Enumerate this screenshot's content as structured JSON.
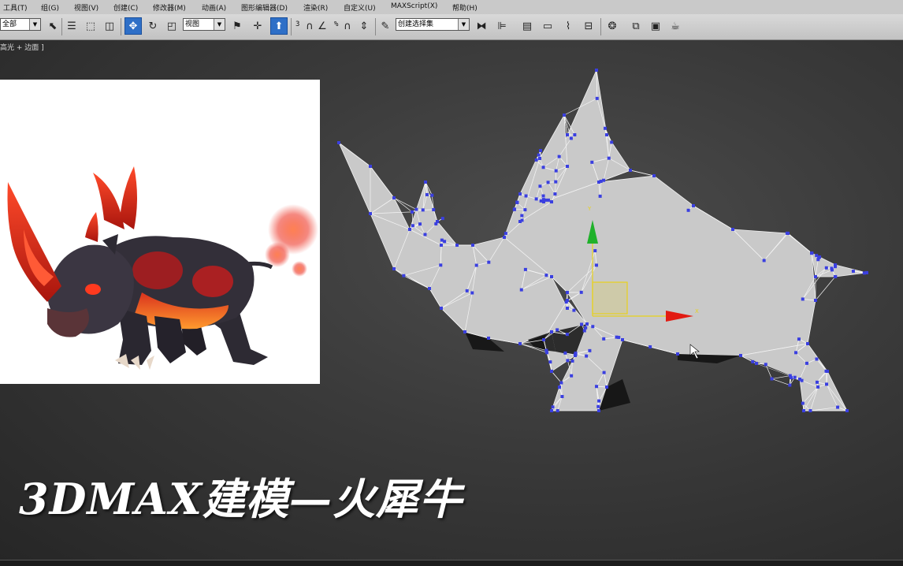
{
  "menu": {
    "items": [
      "工具(T)",
      "组(G)",
      "视图(V)",
      "创建(C)",
      "修改器(M)",
      "动画(A)",
      "图形编辑器(D)",
      "渲染(R)",
      "自定义(U)",
      "MAXScript(X)",
      "帮助(H)"
    ]
  },
  "toolbar": {
    "selection_filter": "全部",
    "reference_coord": "视图",
    "snap_text": "3",
    "angle_snap_text": "%",
    "named_selection": "创建选择集"
  },
  "viewport": {
    "label": "高光 + 边面 ]",
    "title": "3DMAX建模—火犀牛",
    "gizmo_colors": {
      "y_axis": "#1fb12a",
      "x_axis": "#e21b12",
      "plane": "#e8d21a"
    },
    "vertex_color": "#3a3fe0",
    "mesh_color": "#c9c9c9"
  },
  "reference_image": {
    "subject": "fire-rhino-illustration",
    "accent_color": "#e0341f",
    "body_color": "#2d2a33"
  }
}
